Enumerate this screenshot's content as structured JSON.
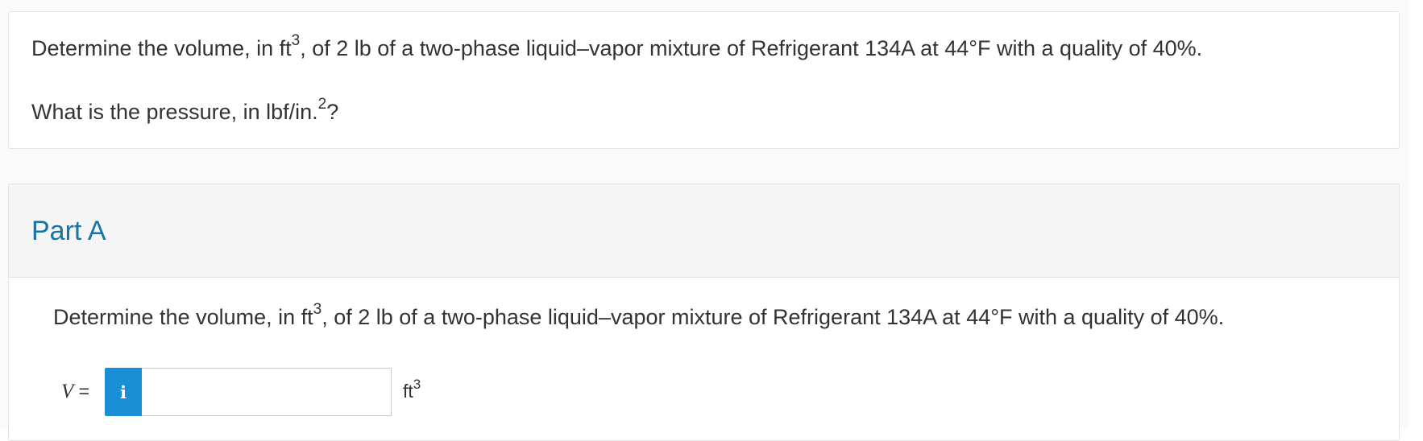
{
  "problem": {
    "statement": {
      "text": "Determine the volume, in ft",
      "exp": "3",
      "rest": ", of 2 lb of a two-phase liquid–vapor mixture of Refrigerant 134A at 44°F with a quality of 40%."
    },
    "pressure_question": {
      "text": "What is the pressure, in lbf/in.",
      "exp": "2",
      "rest": "?"
    }
  },
  "part_a": {
    "title": "Part A",
    "question": {
      "text": "Determine the volume, in ft",
      "exp": "3",
      "rest": ", of 2 lb of a two-phase liquid–vapor mixture of Refrigerant 134A at 44°F with a quality of 40%."
    },
    "answer": {
      "variable": "V",
      "equals": " =",
      "info_icon_glyph": "i",
      "value": "",
      "unit_base": "ft",
      "unit_exp": "3"
    }
  },
  "colors": {
    "accent": "#1a8fd6",
    "part_title": "#1575a8",
    "header_bg": "#f5f5f5",
    "text": "#333333"
  },
  "icons": {
    "info": "info-icon"
  }
}
